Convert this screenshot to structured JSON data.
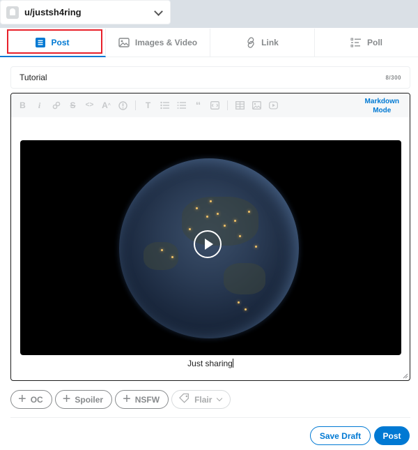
{
  "community": {
    "name": "u/justsh4ring"
  },
  "tabs": [
    {
      "label": "Post",
      "icon": "post-icon",
      "active": true
    },
    {
      "label": "Images & Video",
      "icon": "image-icon"
    },
    {
      "label": "Link",
      "icon": "link-icon"
    },
    {
      "label": "Poll",
      "icon": "poll-icon"
    }
  ],
  "title": {
    "value": "Tutorial",
    "count": "8/300"
  },
  "editor": {
    "mode_line1": "Markdown",
    "mode_line2": "Mode",
    "caption": "Just sharing",
    "toolbar_icons": [
      "bold-icon",
      "italic-icon",
      "link-icon",
      "strikethrough-icon",
      "inline-code-icon",
      "superscript-icon",
      "spoiler-icon",
      "heading-icon",
      "bulleted-list-icon",
      "numbered-list-icon",
      "quote-block-icon",
      "code-block-icon",
      "table-icon",
      "image-icon",
      "video-icon"
    ]
  },
  "tags": {
    "oc": "OC",
    "spoiler": "Spoiler",
    "nsfw": "NSFW",
    "flair": "Flair"
  },
  "actions": {
    "save_draft": "Save Draft",
    "post": "Post"
  },
  "colors": {
    "accent": "#0079d3",
    "highlight": "#e8202a",
    "muted": "#878a8c"
  }
}
